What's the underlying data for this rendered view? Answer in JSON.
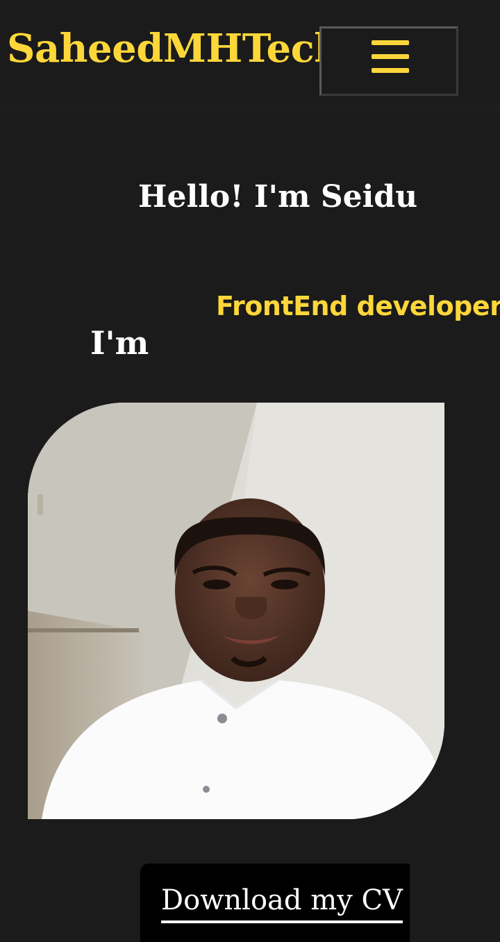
{
  "header": {
    "brand": "SaheedMHTech",
    "menu_icon": "hamburger-menu-icon",
    "accent_color": "#fdd73a",
    "background_color": "#1b1b1b"
  },
  "hero": {
    "greeting": "Hello! I'm Seidu",
    "intro": "I'm",
    "role": "FrontEnd developer",
    "photo": "profile-photo"
  },
  "cta": {
    "download_label": "Download my CV"
  }
}
